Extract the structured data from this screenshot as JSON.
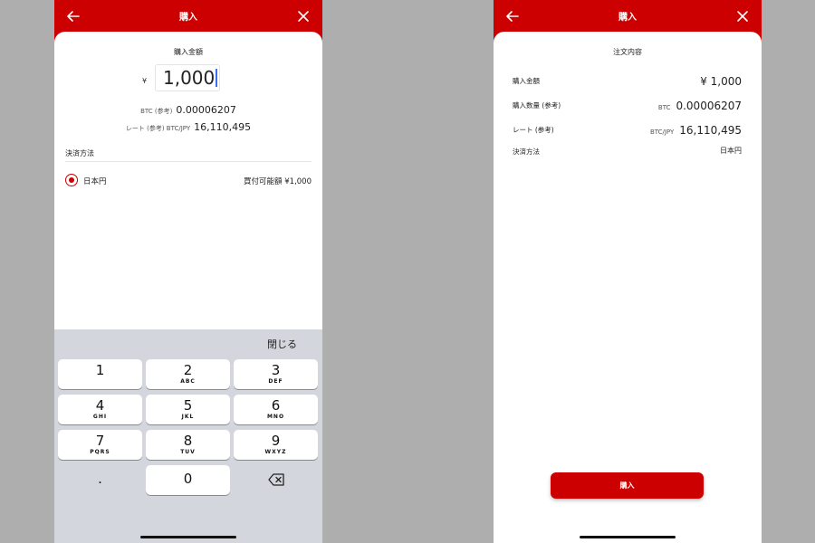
{
  "colors": {
    "brand": "#cc0000",
    "background": "#aeaeae",
    "keyboard": "#d3d6dc",
    "caret": "#3b6df5"
  },
  "left": {
    "header": {
      "title": "購入",
      "back_icon": "arrow-left-icon",
      "close_icon": "close-icon"
    },
    "amount": {
      "label": "購入金額",
      "currency_symbol": "¥",
      "input_value": "1,000"
    },
    "btc_ref": {
      "label": "BTC (参考)",
      "value": "0.00006207"
    },
    "rate_ref": {
      "label": "レート (参考) BTC/JPY",
      "value": "16,110,495"
    },
    "payment": {
      "section_title": "決済方法",
      "option_label": "日本円",
      "selected": true,
      "available_text": "買付可能額 ¥1,000"
    },
    "keyboard": {
      "close_label": "閉じる",
      "keys": [
        {
          "num": "1",
          "letters": ""
        },
        {
          "num": "2",
          "letters": "ABC"
        },
        {
          "num": "3",
          "letters": "DEF"
        },
        {
          "num": "4",
          "letters": "GHI"
        },
        {
          "num": "5",
          "letters": "JKL"
        },
        {
          "num": "6",
          "letters": "MNO"
        },
        {
          "num": "7",
          "letters": "PQRS"
        },
        {
          "num": "8",
          "letters": "TUV"
        },
        {
          "num": "9",
          "letters": "WXYZ"
        }
      ],
      "dot_key": ".",
      "zero_key": "0",
      "delete_icon": "backspace-icon"
    }
  },
  "right": {
    "header": {
      "title": "購入",
      "back_icon": "arrow-left-icon",
      "close_icon": "close-icon"
    },
    "order": {
      "title": "注文内容",
      "rows": [
        {
          "label": "購入金額",
          "unit": "",
          "value": "¥ 1,000"
        },
        {
          "label": "購入数量 (参考)",
          "unit": "BTC",
          "value": "0.00006207"
        },
        {
          "label": "レート (参考)",
          "unit": "BTC/JPY",
          "value": "16,110,495"
        },
        {
          "label": "決済方法",
          "unit": "",
          "value": "日本円"
        }
      ]
    },
    "buy_button_label": "購入"
  }
}
